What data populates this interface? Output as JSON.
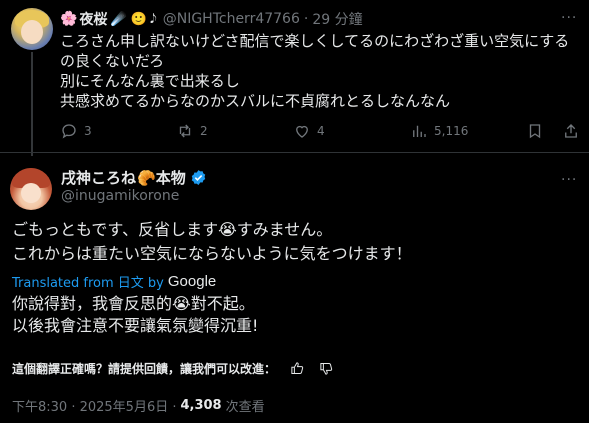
{
  "reply": {
    "flower": "🌸",
    "name": "夜桜",
    "emoji_after_name": "☄️ 🙂",
    "emoji_note": "𝅘𝅥𝅮",
    "handle": "@NIGHTcherr47766",
    "separator": "·",
    "time": "29 分鐘",
    "more": "···",
    "lines": [
      "ころさん申し訳ないけどさ配信で楽しくしてるのにわざわざ重い空気にする",
      "の良くないだろ",
      "別にそんなん裏で出来るし",
      "共感求めてるからなのかスバルに不貞腐れとるしなんなん"
    ],
    "actions": {
      "replies": "3",
      "reposts": "2",
      "likes": "4",
      "views": "5,116"
    }
  },
  "tweet": {
    "name": "戌神ころね",
    "name_emoji": "🥐",
    "name_suffix": "本物",
    "handle": "@inugamikorone",
    "more": "···",
    "lines": [
      "ごもっともです、反省します😭すみません。",
      "これからは重たい空気にならないように気をつけます！"
    ],
    "translated_label": "Translated from 日文 by",
    "translated_by": "Google",
    "translation_lines": [
      "你說得對，我會反思的😭對不起。",
      "以後我會注意不要讓氣氛變得沉重!"
    ],
    "feedback_question": "這個翻譯正確嗎？請提供回饋，讓我們可以改進：",
    "timestamp": "下午8:30 · 2025年5月6日 ·",
    "views": "4,308",
    "views_label": "次查看"
  },
  "colors": {
    "background": "#000000",
    "text": "#e7e9ea",
    "muted": "#71767b",
    "link": "#1d9bf0",
    "verified": "#1d9bf0"
  }
}
